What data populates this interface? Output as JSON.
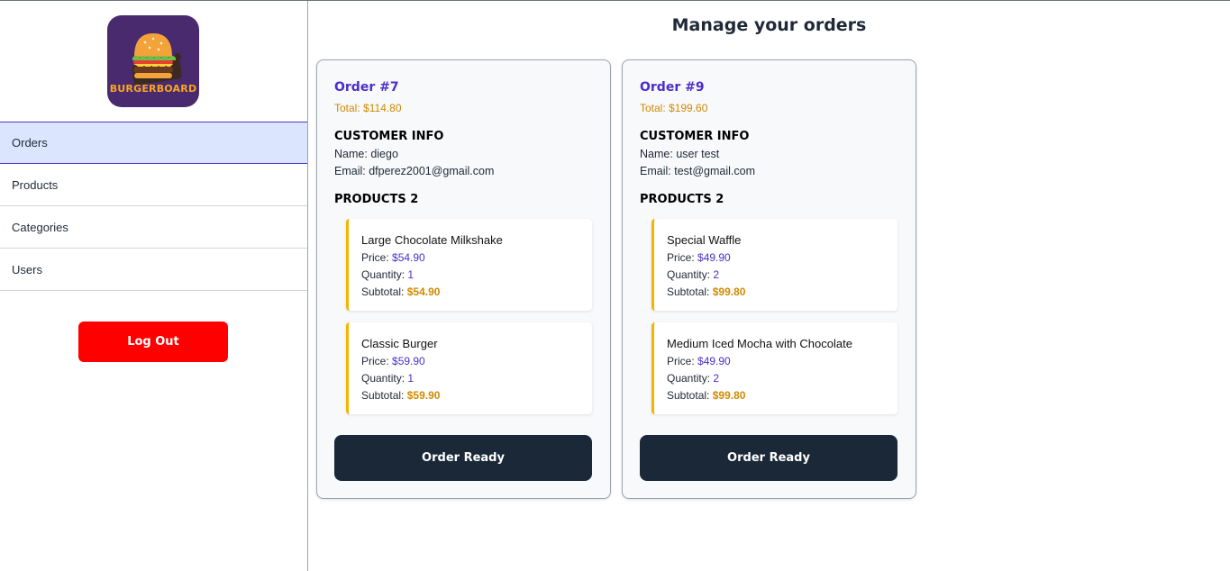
{
  "sidebar": {
    "logo_text": "BURGERBOARD",
    "nav": [
      {
        "label": "Orders",
        "active": true
      },
      {
        "label": "Products",
        "active": false
      },
      {
        "label": "Categories",
        "active": false
      },
      {
        "label": "Users",
        "active": false
      }
    ],
    "logout_label": "Log Out"
  },
  "main": {
    "title": "Manage your orders",
    "orders": [
      {
        "title": "Order #7",
        "total": "Total: $114.80",
        "customer_heading": "CUSTOMER INFO",
        "name_label": "Name:",
        "name": "diego",
        "email_label": "Email:",
        "email": "dfperez2001@gmail.com",
        "products_heading": "PRODUCTS 2",
        "items": [
          {
            "name": "Large Chocolate Milkshake",
            "price_label": "Price:",
            "price": "$54.90",
            "qty_label": "Quantity:",
            "qty": "1",
            "subtotal_label": "Subtotal:",
            "subtotal": "$54.90"
          },
          {
            "name": "Classic Burger",
            "price_label": "Price:",
            "price": "$59.90",
            "qty_label": "Quantity:",
            "qty": "1",
            "subtotal_label": "Subtotal:",
            "subtotal": "$59.90"
          }
        ],
        "button_label": "Order Ready"
      },
      {
        "title": "Order #9",
        "total": "Total: $199.60",
        "customer_heading": "CUSTOMER INFO",
        "name_label": "Name:",
        "name": "user test",
        "email_label": "Email:",
        "email": "test@gmail.com",
        "products_heading": "PRODUCTS 2",
        "items": [
          {
            "name": "Special Waffle",
            "price_label": "Price:",
            "price": "$49.90",
            "qty_label": "Quantity:",
            "qty": "2",
            "subtotal_label": "Subtotal:",
            "subtotal": "$99.80"
          },
          {
            "name": "Medium Iced Mocha with Chocolate",
            "price_label": "Price:",
            "price": "$49.90",
            "qty_label": "Quantity:",
            "qty": "2",
            "subtotal_label": "Subtotal:",
            "subtotal": "$99.80"
          }
        ],
        "button_label": "Order Ready"
      }
    ]
  },
  "colors": {
    "accent_indigo": "#4c2ec9",
    "accent_amber": "#d08a00",
    "logout_red": "#ff0000",
    "button_dark": "#1b2838",
    "active_nav_bg": "#dbe6fe"
  }
}
